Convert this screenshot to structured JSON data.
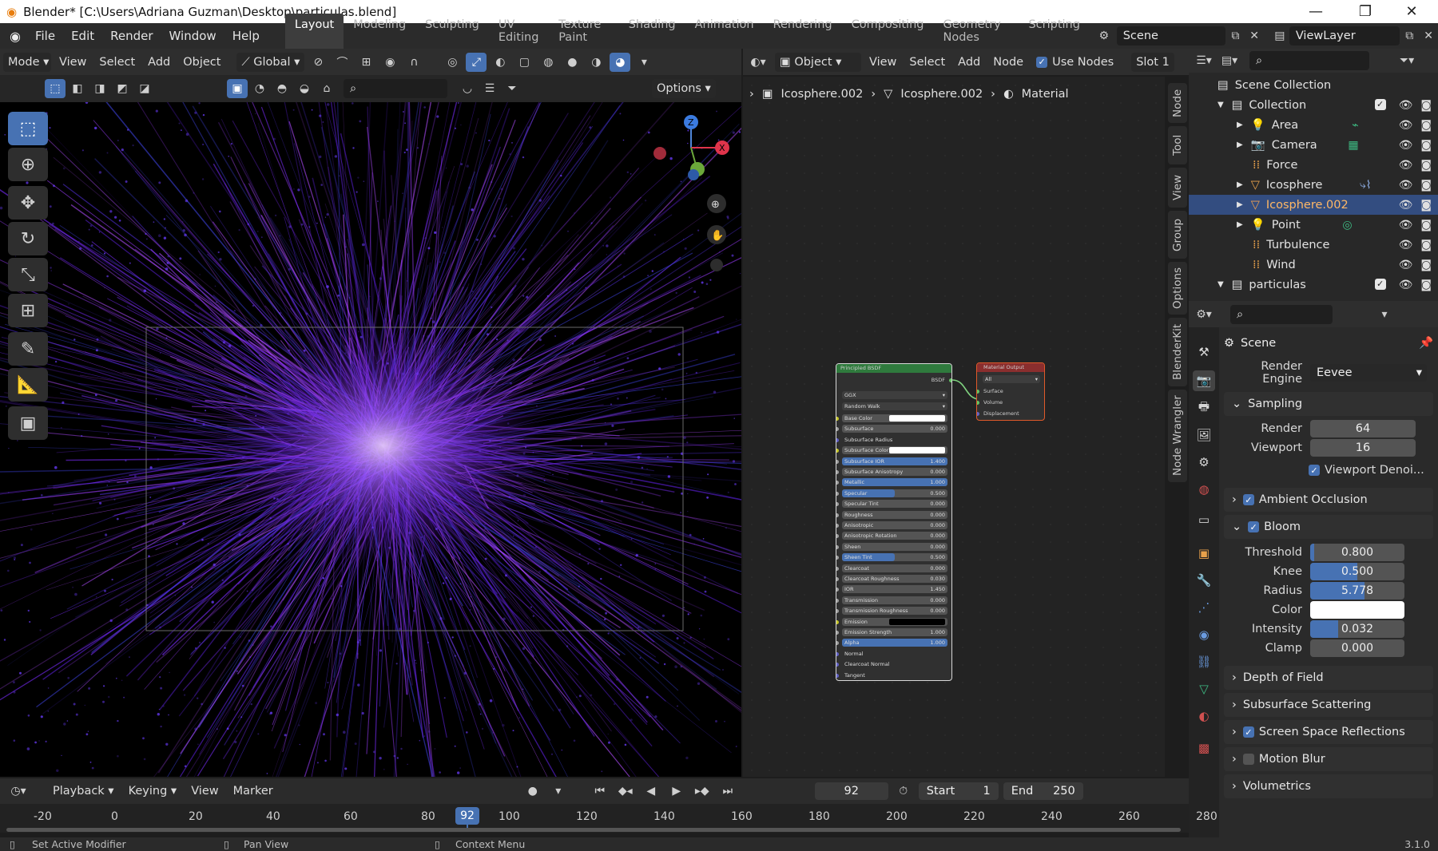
{
  "window": {
    "title": "Blender* [C:\\Users\\Adriana Guzman\\Desktop\\particulas.blend]"
  },
  "menu": [
    "File",
    "Edit",
    "Render",
    "Window",
    "Help"
  ],
  "workspaces": [
    "Layout",
    "Modeling",
    "Sculpting",
    "UV Editing",
    "Texture Paint",
    "Shading",
    "Animation",
    "Rendering",
    "Compositing",
    "Geometry Nodes",
    "Scripting"
  ],
  "active_workspace": "Layout",
  "scene_name": "Scene",
  "view_layer": "ViewLayer",
  "viewport_header": {
    "mode": "Mode",
    "view": "View",
    "select": "Select",
    "add": "Add",
    "object": "Object",
    "transform": "Global",
    "options": "Options"
  },
  "node_header": {
    "object": "Object",
    "view": "View",
    "select": "Select",
    "add": "Add",
    "node": "Node",
    "use_nodes": "Use Nodes",
    "slot": "Slot 1"
  },
  "breadcrumb": [
    "Icosphere.002",
    "Icosphere.002",
    "Material"
  ],
  "side_tabs": [
    "Node",
    "Tool",
    "View",
    "Group",
    "Options",
    "BlenderKit",
    "Node Wrangler"
  ],
  "outliner": {
    "scene_collection": "Scene Collection",
    "rows": [
      {
        "name": "Collection"
      },
      {
        "name": "Area"
      },
      {
        "name": "Camera"
      },
      {
        "name": "Force"
      },
      {
        "name": "Icosphere"
      },
      {
        "name": "Icosphere.002"
      },
      {
        "name": "Point"
      },
      {
        "name": "Turbulence"
      },
      {
        "name": "Wind"
      },
      {
        "name": "particulas"
      }
    ]
  },
  "properties": {
    "context": "Scene",
    "render_engine_label": "Render Engine",
    "render_engine": "Eevee",
    "sampling": {
      "title": "Sampling",
      "render_label": "Render",
      "render": "64",
      "viewport_label": "Viewport",
      "viewport": "16",
      "denoise": "Viewport Denoi..."
    },
    "ambient_occlusion": "Ambient Occlusion",
    "bloom": {
      "title": "Bloom",
      "threshold_label": "Threshold",
      "threshold": "0.800",
      "threshold_frac": 0.04,
      "knee_label": "Knee",
      "knee": "0.500",
      "knee_frac": 0.5,
      "radius_label": "Radius",
      "radius": "5.778",
      "radius_frac": 0.58,
      "color_label": "Color",
      "intensity_label": "Intensity",
      "intensity": "0.032",
      "intensity_frac": 0.3,
      "clamp_label": "Clamp",
      "clamp": "0.000"
    },
    "depth_of_field": "Depth of Field",
    "subsurface_scattering": "Subsurface Scattering",
    "screen_space_reflections": "Screen Space Reflections",
    "motion_blur": "Motion Blur",
    "volumetrics": "Volumetrics"
  },
  "nodes": {
    "bsdf_title": "Principled BSDF",
    "bsdf_out": "BSDF",
    "dist": "GGX",
    "ss_method": "Random Walk",
    "rows": [
      {
        "label": "Base Color",
        "value": ""
      },
      {
        "label": "Subsurface",
        "value": "0.000"
      },
      {
        "label": "Subsurface Radius",
        "value": ""
      },
      {
        "label": "Subsurface Color",
        "value": ""
      },
      {
        "label": "Subsurface IOR",
        "value": "1.400"
      },
      {
        "label": "Subsurface Anisotropy",
        "value": "0.000"
      },
      {
        "label": "Metallic",
        "value": "1.000"
      },
      {
        "label": "Specular",
        "value": "0.500"
      },
      {
        "label": "Specular Tint",
        "value": "0.000"
      },
      {
        "label": "Roughness",
        "value": "0.000"
      },
      {
        "label": "Anisotropic",
        "value": "0.000"
      },
      {
        "label": "Anisotropic Rotation",
        "value": "0.000"
      },
      {
        "label": "Sheen",
        "value": "0.000"
      },
      {
        "label": "Sheen Tint",
        "value": "0.500"
      },
      {
        "label": "Clearcoat",
        "value": "0.000"
      },
      {
        "label": "Clearcoat Roughness",
        "value": "0.030"
      },
      {
        "label": "IOR",
        "value": "1.450"
      },
      {
        "label": "Transmission",
        "value": "0.000"
      },
      {
        "label": "Transmission Roughness",
        "value": "0.000"
      },
      {
        "label": "Emission",
        "value": ""
      },
      {
        "label": "Emission Strength",
        "value": "1.000"
      },
      {
        "label": "Alpha",
        "value": "1.000"
      },
      {
        "label": "Normal",
        "value": ""
      },
      {
        "label": "Clearcoat Normal",
        "value": ""
      },
      {
        "label": "Tangent",
        "value": ""
      }
    ],
    "output_title": "Material Output",
    "output_target": "All",
    "output_sockets": [
      "Surface",
      "Volume",
      "Displacement"
    ]
  },
  "timeline": {
    "playback": "Playback",
    "keying": "Keying",
    "view": "View",
    "marker": "Marker",
    "current_frame": "92",
    "start_label": "Start",
    "start": "1",
    "end_label": "End",
    "end": "250",
    "ticks": [
      "-20",
      "0",
      "20",
      "40",
      "60",
      "80",
      "100",
      "120",
      "140",
      "160",
      "180",
      "200",
      "220",
      "240",
      "260",
      "280"
    ]
  },
  "status": {
    "left": "Set Active Modifier",
    "mid": "Pan View",
    "right": "Context Menu",
    "version": "3.1.0"
  },
  "colors": {
    "accent": "#4772b3",
    "selected_row": "#334d80",
    "particles": "#8a3cff"
  }
}
